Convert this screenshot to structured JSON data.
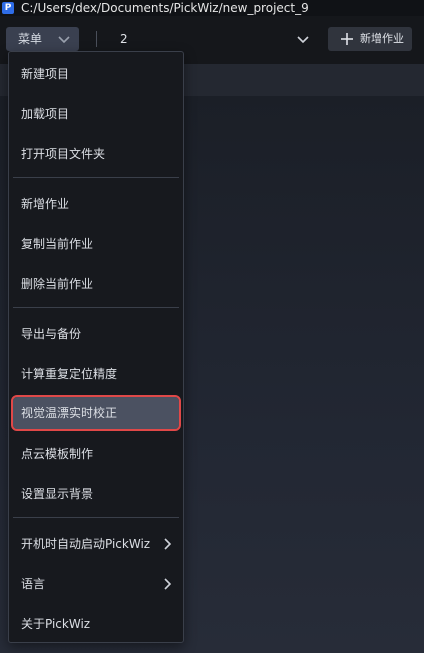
{
  "window": {
    "app_icon_letter": "P",
    "title": "C:/Users/dex/Documents/PickWiz/new_project_9"
  },
  "toolbar": {
    "menu_label": "菜单",
    "job_select_value": "2",
    "add_job_label": "新增作业"
  },
  "menu": {
    "items": [
      {
        "label": "新建项目"
      },
      {
        "label": "加载项目"
      },
      {
        "label": "打开项目文件夹"
      },
      {
        "label": "新增作业"
      },
      {
        "label": "复制当前作业"
      },
      {
        "label": "删除当前作业"
      },
      {
        "label": "导出与备份"
      },
      {
        "label": "计算重复定位精度"
      },
      {
        "label": "视觉温漂实时校正",
        "highlighted": true
      },
      {
        "label": "点云模板制作"
      },
      {
        "label": "设置显示背景"
      },
      {
        "label": "开机时自动启动PickWiz",
        "submenu": true
      },
      {
        "label": "语言",
        "submenu": true
      },
      {
        "label": "关于PickWiz"
      }
    ]
  },
  "colors": {
    "highlight_outline": "#e04848",
    "highlight_bg": "#4b5161",
    "menu_bg": "#17191e",
    "accent_icon": "#2f6de8"
  }
}
